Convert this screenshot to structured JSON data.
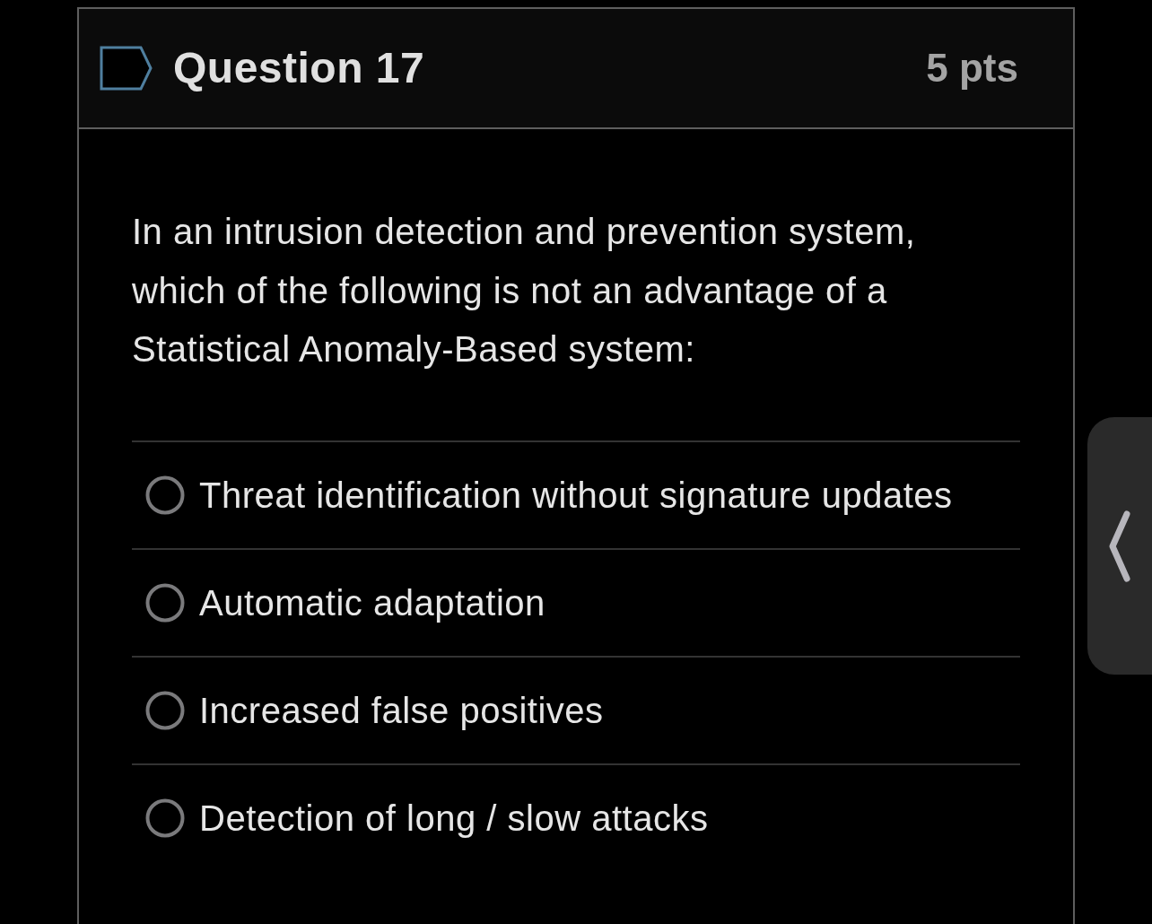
{
  "question": {
    "title": "Question 17",
    "points": "5 pts",
    "flagged": false,
    "text": "In an intrusion detection and prevention system, which of the following is not an advantage of a Statistical Anomaly-Based system:",
    "options": [
      {
        "label": "Threat identification without signature updates",
        "selected": false
      },
      {
        "label": "Automatic adaptation",
        "selected": false
      },
      {
        "label": "Increased false positives",
        "selected": false
      },
      {
        "label": "Detection of long / slow attacks",
        "selected": false
      }
    ]
  },
  "side_panel": {
    "expanded": false
  }
}
